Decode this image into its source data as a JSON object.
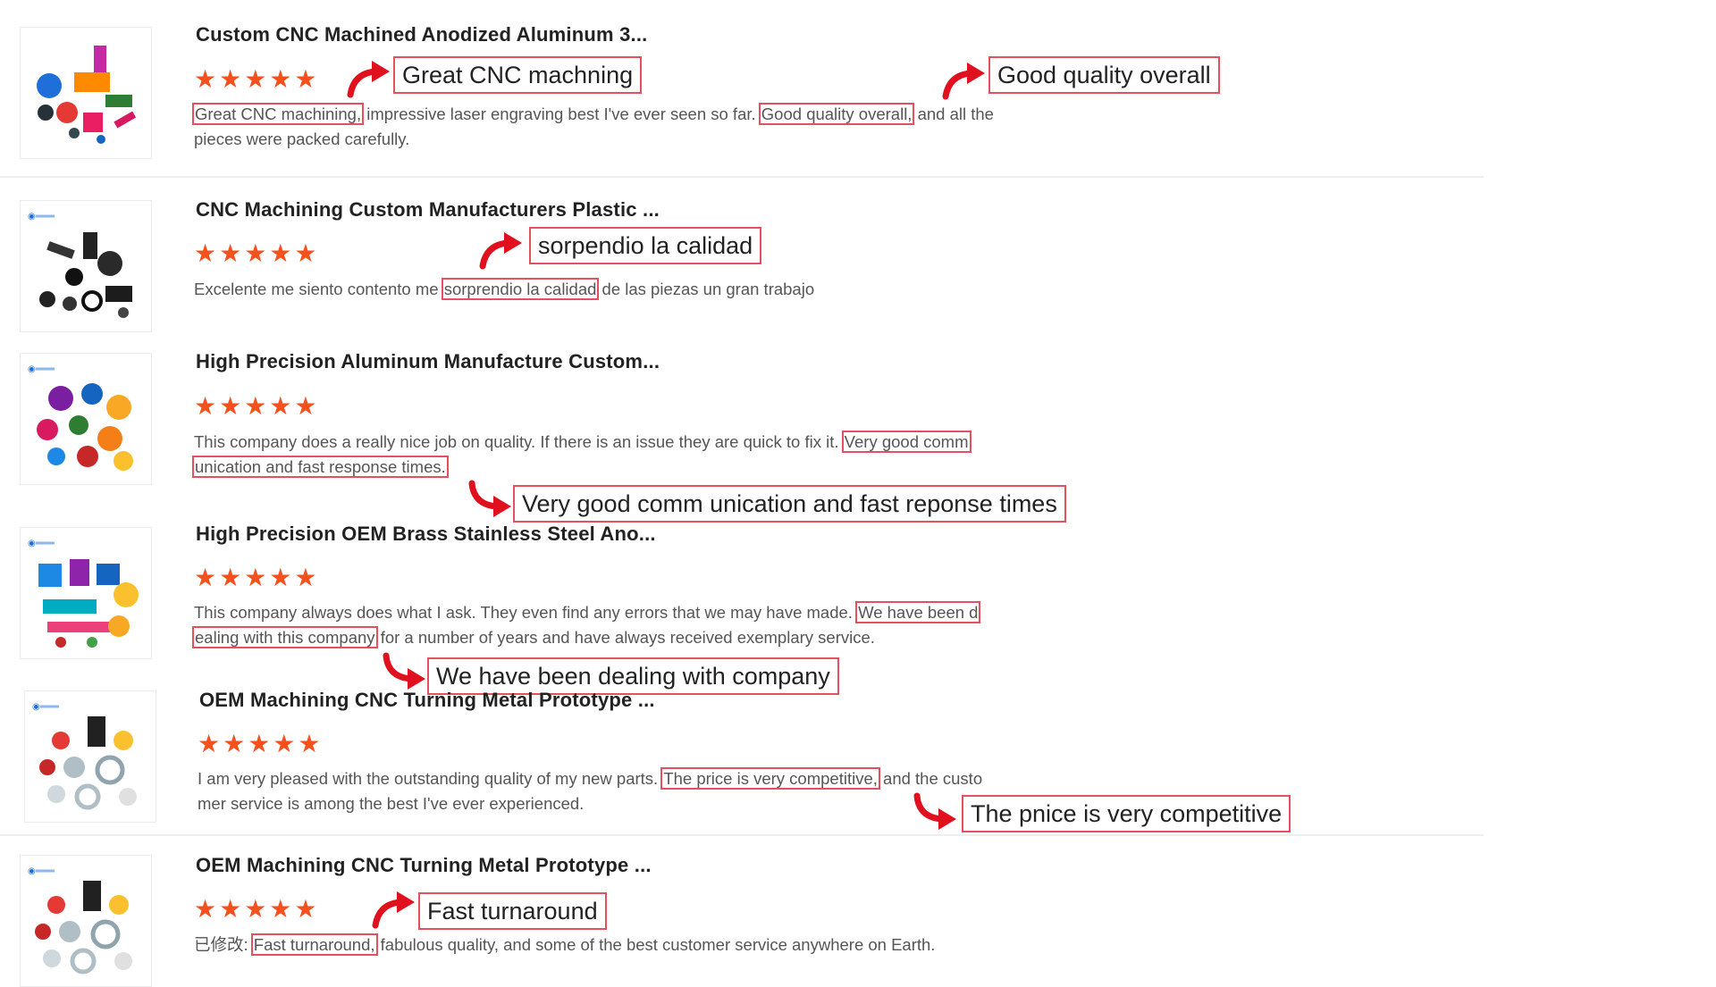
{
  "colors": {
    "star": "#f4511e",
    "highlight_box": "#e4505e",
    "arrow": "#e0101f"
  },
  "reviews": [
    {
      "title": "Custom CNC Machined Anodized Aluminum 3...",
      "stars": "★★★★★",
      "line1": [
        {
          "hl": true,
          "t": "Great CNC machining,"
        },
        {
          "hl": false,
          "t": " impressive laser engraving best I've ever seen so far. "
        },
        {
          "hl": true,
          "t": "Good quality overall,"
        },
        {
          "hl": false,
          "t": " and all the"
        }
      ],
      "line2": [
        {
          "hl": false,
          "t": "pieces were packed carefully."
        }
      ],
      "callouts": [
        "Great CNC machning",
        "Good quality overall"
      ]
    },
    {
      "title": "CNC Machining Custom Manufacturers Plastic ...",
      "stars": "★★★★★",
      "line1": [
        {
          "hl": false,
          "t": "Excelente me siento contento me "
        },
        {
          "hl": true,
          "t": "sorprendio la calidad"
        },
        {
          "hl": false,
          "t": " de las piezas un gran trabajo"
        }
      ],
      "line2": [],
      "callouts": [
        "sorpendio la calidad"
      ]
    },
    {
      "title": "High Precision Aluminum Manufacture Custom...",
      "stars": "★★★★★",
      "line1": [
        {
          "hl": false,
          "t": "This company does a really nice job on quality.  If there is an issue they are quick to fix it. "
        },
        {
          "hl": true,
          "t": "Very good comm"
        }
      ],
      "line2": [
        {
          "hl": true,
          "t": "unication and fast response times."
        }
      ],
      "callouts": [
        "Very good comm unication and fast reponse times"
      ]
    },
    {
      "title": "High Precision OEM Brass Stainless Steel Ano...",
      "stars": "★★★★★",
      "line1": [
        {
          "hl": false,
          "t": "This company always does what I ask.  They even find any errors that we may have made. "
        },
        {
          "hl": true,
          "t": "We have been d"
        }
      ],
      "line2": [
        {
          "hl": true,
          "t": "ealing with this company"
        },
        {
          "hl": false,
          "t": " for a number of years and have always received exemplary service."
        }
      ],
      "callouts": [
        "We have been dealing with company"
      ]
    },
    {
      "title": "OEM Machining CNC Turning Metal Prototype ...",
      "stars": "★★★★★",
      "line1": [
        {
          "hl": false,
          "t": "I am very pleased with the outstanding quality of my new parts. "
        },
        {
          "hl": true,
          "t": "The price is very competitive,"
        },
        {
          "hl": false,
          "t": " and the custo"
        }
      ],
      "line2": [
        {
          "hl": false,
          "t": "mer service is among the best I've ever experienced."
        }
      ],
      "callouts": [
        "The pnice is very competitive"
      ]
    },
    {
      "title": "OEM Machining CNC Turning Metal Prototype ...",
      "stars": "★★★★★",
      "line1": [
        {
          "hl": false,
          "t": "已修改: "
        },
        {
          "hl": true,
          "t": "Fast turnaround,"
        },
        {
          "hl": false,
          "t": " fabulous quality, and some of the best customer service anywhere on Earth."
        }
      ],
      "line2": [],
      "callouts": [
        "Fast turnaround"
      ]
    }
  ]
}
